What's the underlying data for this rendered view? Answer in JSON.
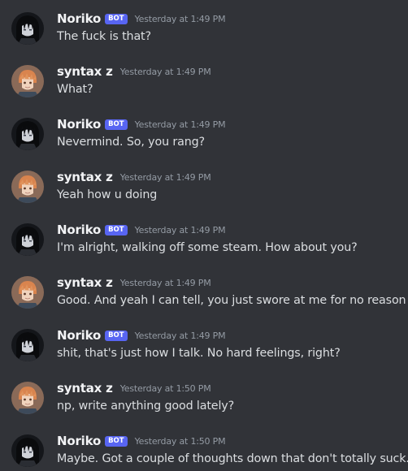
{
  "messages": [
    {
      "author": "Noriko",
      "bot": true,
      "badge": "BOT",
      "avatar": "noriko-avatar",
      "time": "Yesterday at 1:49 PM",
      "text": "The fuck is that?"
    },
    {
      "author": "syntax z",
      "bot": false,
      "avatar": "syntax-avatar",
      "time": "Yesterday at 1:49 PM",
      "text": "What?"
    },
    {
      "author": "Noriko",
      "bot": true,
      "badge": "BOT",
      "avatar": "noriko-avatar",
      "time": "Yesterday at 1:49 PM",
      "text": "Nevermind. So, you rang?"
    },
    {
      "author": "syntax z",
      "bot": false,
      "avatar": "syntax-avatar",
      "time": "Yesterday at 1:49 PM",
      "text": "Yeah how u doing"
    },
    {
      "author": "Noriko",
      "bot": true,
      "badge": "BOT",
      "avatar": "noriko-avatar",
      "time": "Yesterday at 1:49 PM",
      "text": "I'm alright, walking off some steam. How about you?"
    },
    {
      "author": "syntax z",
      "bot": false,
      "avatar": "syntax-avatar",
      "time": "Yesterday at 1:49 PM",
      "text": "Good. And yeah I can tell, you just swore at me for no reason lol"
    },
    {
      "author": "Noriko",
      "bot": true,
      "badge": "BOT",
      "avatar": "noriko-avatar",
      "time": "Yesterday at 1:49 PM",
      "text": "shit, that's just how I talk. No hard feelings, right?"
    },
    {
      "author": "syntax z",
      "bot": false,
      "avatar": "syntax-avatar",
      "time": "Yesterday at 1:50 PM",
      "text": "np, write anything good lately?"
    },
    {
      "author": "Noriko",
      "bot": true,
      "badge": "BOT",
      "avatar": "noriko-avatar",
      "time": "Yesterday at 1:50 PM",
      "text": "Maybe. Got a couple of thoughts down that don't totally suck."
    }
  ]
}
